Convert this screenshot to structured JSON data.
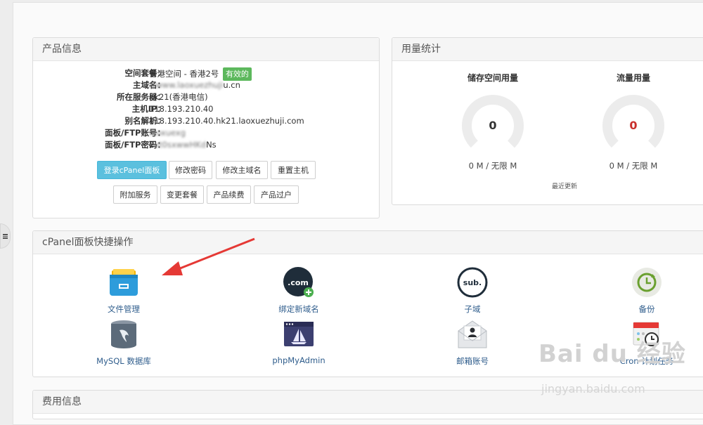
{
  "product": {
    "title": "产品信息",
    "rows": [
      {
        "label": "空间套餐：",
        "value": "香港空间 - 香港2号",
        "badge": "有效的"
      },
      {
        "label": "主域名：",
        "value": "u.cn",
        "masked": "wwww.laoxuezhuji"
      },
      {
        "label": "所在服务器：",
        "value": "hk21(香港电信)"
      },
      {
        "label": "主机IP：",
        "value": "118.193.210.40"
      },
      {
        "label": "别名解析：",
        "value": "118.193.210.40.hk21.laoxuezhuji.com"
      },
      {
        "label": "面板/FTP账号：",
        "value": "",
        "masked": "laoxuexg"
      },
      {
        "label": "面板/FTP密码：",
        "value": "2",
        "masked": "xt0sxwwHKd",
        "value_suffix": "Ns"
      }
    ],
    "buttons_row1": [
      "登录cPanel面板",
      "修改密码",
      "修改主域名",
      "重置主机"
    ],
    "buttons_row2": [
      "附加服务",
      "变更套餐",
      "产品续费",
      "产品过户"
    ]
  },
  "usage": {
    "title": "用量统计",
    "storage": {
      "title": "储存空间用量",
      "value": "0",
      "caption": "0 M / 无限 M",
      "color": "#333333"
    },
    "traffic": {
      "title": "流量用量",
      "value": "0",
      "caption": "0 M / 无限 M",
      "color": "#c9302c"
    },
    "recent_update": "最近更新"
  },
  "cpanel": {
    "title": "cPanel面板快捷操作",
    "tools": [
      {
        "label": "文件管理",
        "icon": "file-manager-icon"
      },
      {
        "label": "绑定新域名",
        "icon": "com-domain-icon",
        "icon_text": ".com"
      },
      {
        "label": "子域",
        "icon": "subdomain-icon",
        "icon_text": "sub."
      },
      {
        "label": "备份",
        "icon": "backup-icon"
      },
      {
        "label": "MySQL 数据库",
        "icon": "mysql-icon"
      },
      {
        "label": "phpMyAdmin",
        "icon": "phpmyadmin-icon"
      },
      {
        "label": "邮箱账号",
        "icon": "email-account-icon"
      },
      {
        "label": "Cron 计划任务",
        "icon": "cron-jobs-icon"
      }
    ]
  },
  "fee": {
    "title": "费用信息"
  },
  "watermark": {
    "brand": "Bai du 经验",
    "url": "jingyan.baidu.com"
  },
  "colors": {
    "primary_button": "#5bc0de",
    "active_badge": "#5cb85c",
    "link": "#2f5d8c",
    "arrow": "#e53935"
  }
}
